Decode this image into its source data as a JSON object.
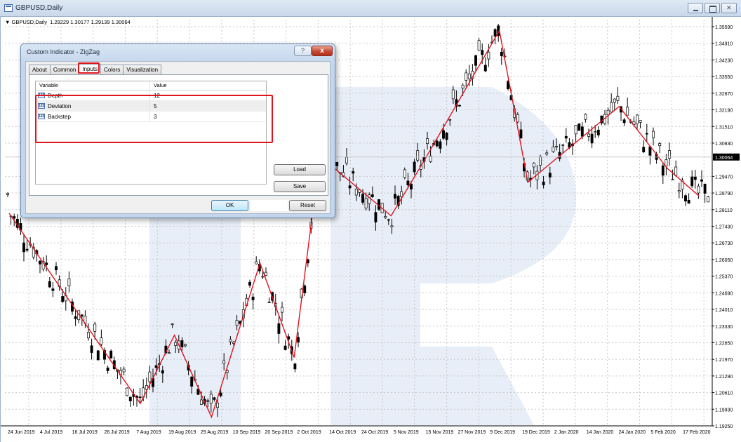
{
  "window": {
    "title": "GBPUSD,Daily",
    "controls": [
      "minimize",
      "maximize",
      "close"
    ]
  },
  "chart_info": "GBPUSD,Daily  1.29229 1.30177 1.29139 1.30064",
  "current_price": "1.30064",
  "colors": {
    "zigzag": "#e0141e",
    "bull_candle": "#ffffff",
    "bear_candle": "#000000",
    "highlight": "#e0141e",
    "price_tag_bg": "#000000"
  },
  "chart_data": {
    "type": "candlestick",
    "symbol": "GBPUSD",
    "timeframe": "Daily",
    "ylim": [
      1.1925,
      1.3559
    ],
    "price_ticks": [
      "1.35590",
      "1.34910",
      "1.34230",
      "1.33550",
      "1.32870",
      "1.32190",
      "1.31510",
      "1.30830",
      "1.30064",
      "1.29470",
      "1.28790",
      "1.28110",
      "1.27430",
      "1.26730",
      "1.26050",
      "1.25370",
      "1.24690",
      "1.24010",
      "1.23330",
      "1.22650",
      "1.21970",
      "1.21290",
      "1.20610",
      "1.19930",
      "1.19250"
    ],
    "date_ticks": [
      "24 Jun 2019",
      "4 Jul 2019",
      "16 Jul 2019",
      "26 Jul 2019",
      "7 Aug 2019",
      "19 Aug 2019",
      "29 Aug 2019",
      "10 Sep 2019",
      "20 Sep 2019",
      "2 Oct 2019",
      "14 Oct 2019",
      "24 Oct 2019",
      "5 Nov 2019",
      "15 Nov 2019",
      "27 Nov 2019",
      "9 Dec 2019",
      "19 Dec 2019",
      "2 Jan 2020",
      "14 Jan 2020",
      "24 Jan 2020",
      "5 Feb 2020",
      "17 Feb 2020"
    ],
    "zigzag_points": [
      {
        "date": "24 Jun 2019",
        "price": 1.278
      },
      {
        "date": "9 Aug 2019",
        "price": 1.2015
      },
      {
        "date": "21 Aug 2019",
        "price": 1.229
      },
      {
        "date": "3 Sep 2019",
        "price": 1.196
      },
      {
        "date": "20 Sep 2019",
        "price": 1.258
      },
      {
        "date": "2 Oct 2019",
        "price": 1.22
      },
      {
        "date": "11 Oct 2019",
        "price": 1.301
      },
      {
        "date": "5 Nov 2019",
        "price": 1.277
      },
      {
        "date": "16 Nov 2019",
        "price": 1.298
      },
      {
        "date": "13 Dec 2019",
        "price": 1.3515
      },
      {
        "date": "23 Dec 2019",
        "price": 1.2905
      },
      {
        "date": "24 Jan 2020",
        "price": 1.321
      },
      {
        "date": "10 Feb 2020",
        "price": 1.296
      },
      {
        "date": "21 Feb 2020",
        "price": 1.285
      }
    ],
    "series": [
      {
        "name": "ZigZag",
        "type": "line"
      }
    ]
  },
  "dialog": {
    "title": "Custom Indicator - ZigZag",
    "help_label": "?",
    "close_label": "x",
    "tabs": [
      {
        "label": "About"
      },
      {
        "label": "Common"
      },
      {
        "label": "Inputs"
      },
      {
        "label": "Colors"
      },
      {
        "label": "Visualization"
      }
    ],
    "active_tab": "Inputs",
    "grid_headers": {
      "variable": "Variable",
      "value": "Value"
    },
    "inputs": [
      {
        "icon": "123",
        "variable": "Depth",
        "value": "12"
      },
      {
        "icon": "123",
        "variable": "Deviation",
        "value": "5"
      },
      {
        "icon": "123",
        "variable": "Backstep",
        "value": "3"
      }
    ],
    "buttons": {
      "load": "Load",
      "save": "Save",
      "ok": "OK",
      "reset": "Reset"
    }
  }
}
